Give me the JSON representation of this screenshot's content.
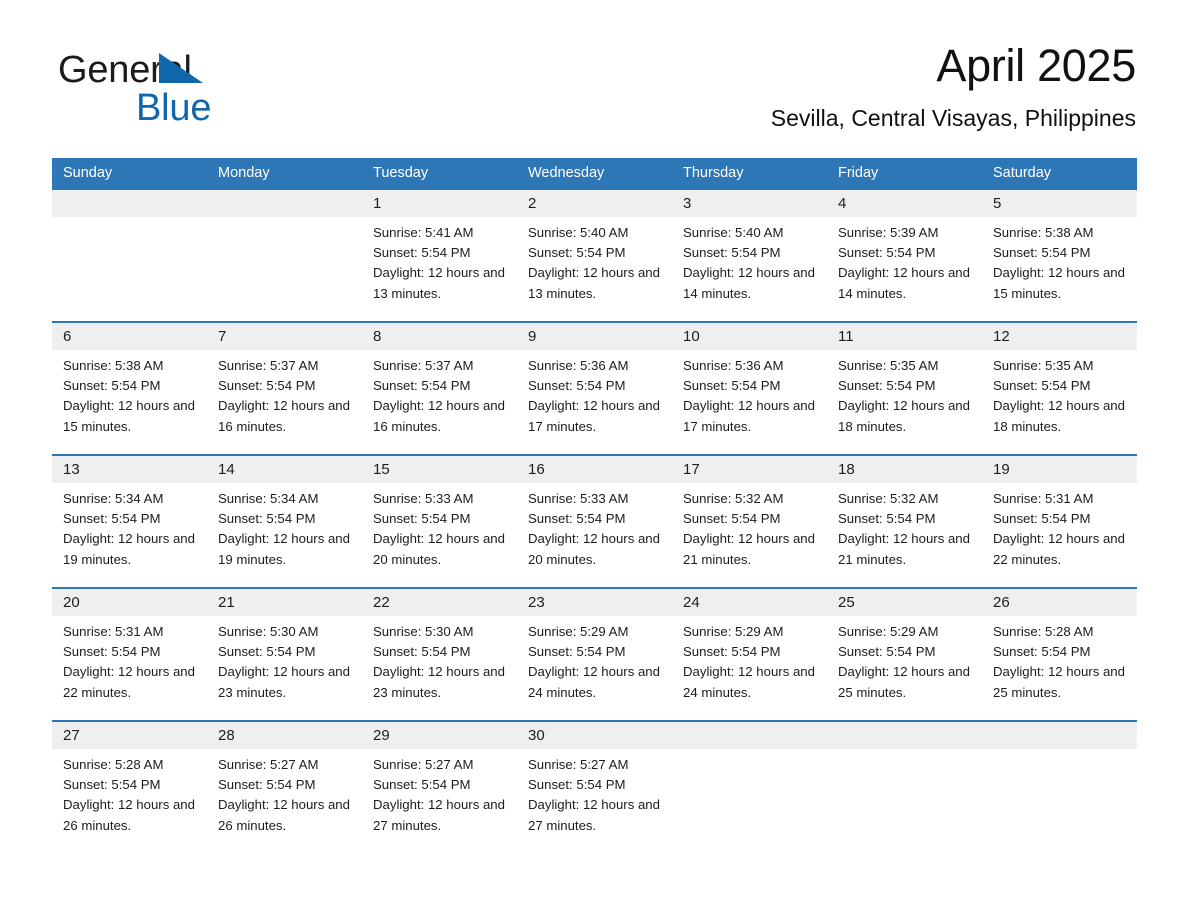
{
  "brand": {
    "name_dark": "General",
    "name_light": "Blue",
    "triangle_color": "#1067ac",
    "logo_icon": "triangle-icon"
  },
  "header": {
    "month_title": "April 2025",
    "location": "Sevilla, Central Visayas, Philippines"
  },
  "theme": {
    "header_blue": "#2e77b7",
    "day_band_gray": "#efefef",
    "text_dark": "#1d1d1d",
    "page_background": "#ffffff"
  },
  "weekdays": [
    "Sunday",
    "Monday",
    "Tuesday",
    "Wednesday",
    "Thursday",
    "Friday",
    "Saturday"
  ],
  "weeks": [
    [
      {
        "date": "",
        "sunrise": "",
        "sunset": "",
        "daylight": ""
      },
      {
        "date": "",
        "sunrise": "",
        "sunset": "",
        "daylight": ""
      },
      {
        "date": "1",
        "sunrise": "Sunrise: 5:41 AM",
        "sunset": "Sunset: 5:54 PM",
        "daylight": "Daylight: 12 hours and 13 minutes."
      },
      {
        "date": "2",
        "sunrise": "Sunrise: 5:40 AM",
        "sunset": "Sunset: 5:54 PM",
        "daylight": "Daylight: 12 hours and 13 minutes."
      },
      {
        "date": "3",
        "sunrise": "Sunrise: 5:40 AM",
        "sunset": "Sunset: 5:54 PM",
        "daylight": "Daylight: 12 hours and 14 minutes."
      },
      {
        "date": "4",
        "sunrise": "Sunrise: 5:39 AM",
        "sunset": "Sunset: 5:54 PM",
        "daylight": "Daylight: 12 hours and 14 minutes."
      },
      {
        "date": "5",
        "sunrise": "Sunrise: 5:38 AM",
        "sunset": "Sunset: 5:54 PM",
        "daylight": "Daylight: 12 hours and 15 minutes."
      }
    ],
    [
      {
        "date": "6",
        "sunrise": "Sunrise: 5:38 AM",
        "sunset": "Sunset: 5:54 PM",
        "daylight": "Daylight: 12 hours and 15 minutes."
      },
      {
        "date": "7",
        "sunrise": "Sunrise: 5:37 AM",
        "sunset": "Sunset: 5:54 PM",
        "daylight": "Daylight: 12 hours and 16 minutes."
      },
      {
        "date": "8",
        "sunrise": "Sunrise: 5:37 AM",
        "sunset": "Sunset: 5:54 PM",
        "daylight": "Daylight: 12 hours and 16 minutes."
      },
      {
        "date": "9",
        "sunrise": "Sunrise: 5:36 AM",
        "sunset": "Sunset: 5:54 PM",
        "daylight": "Daylight: 12 hours and 17 minutes."
      },
      {
        "date": "10",
        "sunrise": "Sunrise: 5:36 AM",
        "sunset": "Sunset: 5:54 PM",
        "daylight": "Daylight: 12 hours and 17 minutes."
      },
      {
        "date": "11",
        "sunrise": "Sunrise: 5:35 AM",
        "sunset": "Sunset: 5:54 PM",
        "daylight": "Daylight: 12 hours and 18 minutes."
      },
      {
        "date": "12",
        "sunrise": "Sunrise: 5:35 AM",
        "sunset": "Sunset: 5:54 PM",
        "daylight": "Daylight: 12 hours and 18 minutes."
      }
    ],
    [
      {
        "date": "13",
        "sunrise": "Sunrise: 5:34 AM",
        "sunset": "Sunset: 5:54 PM",
        "daylight": "Daylight: 12 hours and 19 minutes."
      },
      {
        "date": "14",
        "sunrise": "Sunrise: 5:34 AM",
        "sunset": "Sunset: 5:54 PM",
        "daylight": "Daylight: 12 hours and 19 minutes."
      },
      {
        "date": "15",
        "sunrise": "Sunrise: 5:33 AM",
        "sunset": "Sunset: 5:54 PM",
        "daylight": "Daylight: 12 hours and 20 minutes."
      },
      {
        "date": "16",
        "sunrise": "Sunrise: 5:33 AM",
        "sunset": "Sunset: 5:54 PM",
        "daylight": "Daylight: 12 hours and 20 minutes."
      },
      {
        "date": "17",
        "sunrise": "Sunrise: 5:32 AM",
        "sunset": "Sunset: 5:54 PM",
        "daylight": "Daylight: 12 hours and 21 minutes."
      },
      {
        "date": "18",
        "sunrise": "Sunrise: 5:32 AM",
        "sunset": "Sunset: 5:54 PM",
        "daylight": "Daylight: 12 hours and 21 minutes."
      },
      {
        "date": "19",
        "sunrise": "Sunrise: 5:31 AM",
        "sunset": "Sunset: 5:54 PM",
        "daylight": "Daylight: 12 hours and 22 minutes."
      }
    ],
    [
      {
        "date": "20",
        "sunrise": "Sunrise: 5:31 AM",
        "sunset": "Sunset: 5:54 PM",
        "daylight": "Daylight: 12 hours and 22 minutes."
      },
      {
        "date": "21",
        "sunrise": "Sunrise: 5:30 AM",
        "sunset": "Sunset: 5:54 PM",
        "daylight": "Daylight: 12 hours and 23 minutes."
      },
      {
        "date": "22",
        "sunrise": "Sunrise: 5:30 AM",
        "sunset": "Sunset: 5:54 PM",
        "daylight": "Daylight: 12 hours and 23 minutes."
      },
      {
        "date": "23",
        "sunrise": "Sunrise: 5:29 AM",
        "sunset": "Sunset: 5:54 PM",
        "daylight": "Daylight: 12 hours and 24 minutes."
      },
      {
        "date": "24",
        "sunrise": "Sunrise: 5:29 AM",
        "sunset": "Sunset: 5:54 PM",
        "daylight": "Daylight: 12 hours and 24 minutes."
      },
      {
        "date": "25",
        "sunrise": "Sunrise: 5:29 AM",
        "sunset": "Sunset: 5:54 PM",
        "daylight": "Daylight: 12 hours and 25 minutes."
      },
      {
        "date": "26",
        "sunrise": "Sunrise: 5:28 AM",
        "sunset": "Sunset: 5:54 PM",
        "daylight": "Daylight: 12 hours and 25 minutes."
      }
    ],
    [
      {
        "date": "27",
        "sunrise": "Sunrise: 5:28 AM",
        "sunset": "Sunset: 5:54 PM",
        "daylight": "Daylight: 12 hours and 26 minutes."
      },
      {
        "date": "28",
        "sunrise": "Sunrise: 5:27 AM",
        "sunset": "Sunset: 5:54 PM",
        "daylight": "Daylight: 12 hours and 26 minutes."
      },
      {
        "date": "29",
        "sunrise": "Sunrise: 5:27 AM",
        "sunset": "Sunset: 5:54 PM",
        "daylight": "Daylight: 12 hours and 27 minutes."
      },
      {
        "date": "30",
        "sunrise": "Sunrise: 5:27 AM",
        "sunset": "Sunset: 5:54 PM",
        "daylight": "Daylight: 12 hours and 27 minutes."
      },
      {
        "date": "",
        "sunrise": "",
        "sunset": "",
        "daylight": ""
      },
      {
        "date": "",
        "sunrise": "",
        "sunset": "",
        "daylight": ""
      },
      {
        "date": "",
        "sunrise": "",
        "sunset": "",
        "daylight": ""
      }
    ]
  ]
}
